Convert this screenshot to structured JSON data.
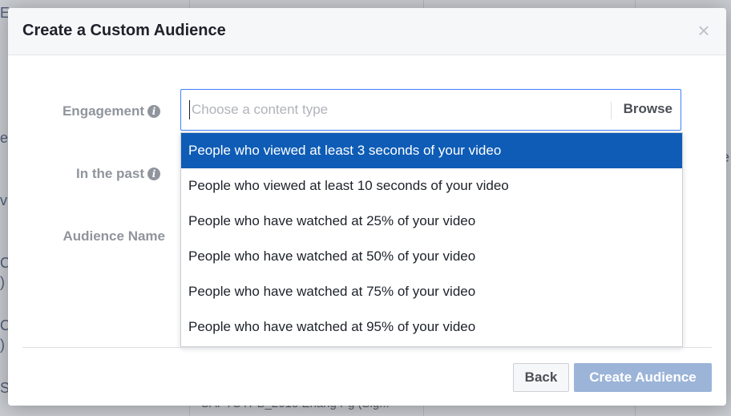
{
  "dialog": {
    "title": "Create a Custom Audience",
    "close_symbol": "×"
  },
  "form": {
    "engagement_label": "Engagement",
    "in_the_past_label": "In the past",
    "audience_name_label": "Audience Name",
    "info_symbol": "i",
    "content_type_placeholder": "Choose a content type",
    "browse_label": "Browse"
  },
  "dropdown": {
    "selected_index": 0,
    "options": [
      "People who viewed at least 3 seconds of your video",
      "People who viewed at least 10 seconds of your video",
      "People who have watched at 25% of your video",
      "People who have watched at 50% of your video",
      "People who have watched at 75% of your video",
      "People who have watched at 95% of your video"
    ]
  },
  "footer": {
    "back_label": "Back",
    "create_label": "Create Audience"
  },
  "background": {
    "fragments": [
      "E",
      "e",
      "v",
      "C",
      ")",
      "C",
      ")",
      "S",
      "e"
    ],
    "bottom_text": "CAPTOTPB_2015 Enang Pg (Sig..."
  },
  "icons": {
    "info": "info-circle-icon",
    "close": "close-icon"
  },
  "colors": {
    "selected_option": "#0e5cb6",
    "focus_border": "#4080ff",
    "disabled_primary": "#9cb4d8"
  }
}
